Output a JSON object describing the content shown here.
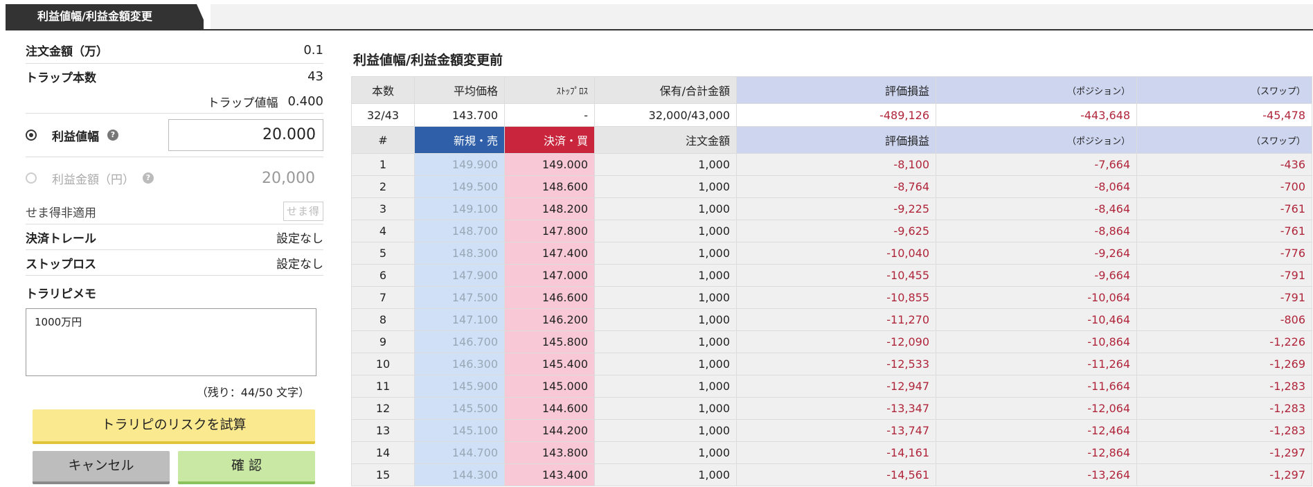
{
  "tab": {
    "active_label": "利益値幅/利益金額変更"
  },
  "form": {
    "order_amount_label": "注文金額（万）",
    "order_amount_value": "0.1",
    "trap_count_label": "トラップ本数",
    "trap_count_value": "43",
    "trap_width_label": "トラップ値幅",
    "trap_width_value": "0.400",
    "profit_width_label": "利益値幅",
    "profit_width_value": "20.000",
    "profit_amount_label": "利益金額（円）",
    "profit_amount_value": "20,000",
    "sema_label": "せま得非適用",
    "sema_icon_text": "せま得",
    "trail_label": "決済トレール",
    "trail_value": "設定なし",
    "stoploss_label": "ストップロス",
    "stoploss_value": "設定なし",
    "memo_label": "トラリピメモ",
    "memo_value": "1000万円",
    "remaining": "（残り：44/50 文字）",
    "risk_button": "トラリピのリスクを試算",
    "cancel_button": "キャンセル",
    "confirm_button": "確 認",
    "help_glyph": "?"
  },
  "summary": {
    "title": "利益値幅/利益金額変更前",
    "headers": [
      "本数",
      "平均価格",
      "ｽﾄｯﾌﾟﾛｽ",
      "保有/合計金額",
      "評価損益",
      "（ポジション）",
      "（スワップ）"
    ],
    "values": [
      "32/43",
      "143.700",
      "-",
      "32,000/43,000",
      "-489,126",
      "-443,648",
      "-45,478"
    ]
  },
  "table": {
    "headers": [
      "#",
      "新規・売",
      "決済・買",
      "注文金額",
      "評価損益",
      "（ポジション）",
      "（スワップ）"
    ],
    "rows": [
      [
        "1",
        "149.900",
        "149.000",
        "1,000",
        "-8,100",
        "-7,664",
        "-436"
      ],
      [
        "2",
        "149.500",
        "148.600",
        "1,000",
        "-8,764",
        "-8,064",
        "-700"
      ],
      [
        "3",
        "149.100",
        "148.200",
        "1,000",
        "-9,225",
        "-8,464",
        "-761"
      ],
      [
        "4",
        "148.700",
        "147.800",
        "1,000",
        "-9,625",
        "-8,864",
        "-761"
      ],
      [
        "5",
        "148.300",
        "147.400",
        "1,000",
        "-10,040",
        "-9,264",
        "-776"
      ],
      [
        "6",
        "147.900",
        "147.000",
        "1,000",
        "-10,455",
        "-9,664",
        "-791"
      ],
      [
        "7",
        "147.500",
        "146.600",
        "1,000",
        "-10,855",
        "-10,064",
        "-791"
      ],
      [
        "8",
        "147.100",
        "146.200",
        "1,000",
        "-11,270",
        "-10,464",
        "-806"
      ],
      [
        "9",
        "146.700",
        "145.800",
        "1,000",
        "-12,090",
        "-10,864",
        "-1,226"
      ],
      [
        "10",
        "146.300",
        "145.400",
        "1,000",
        "-12,533",
        "-11,264",
        "-1,269"
      ],
      [
        "11",
        "145.900",
        "145.000",
        "1,000",
        "-12,947",
        "-11,664",
        "-1,283"
      ],
      [
        "12",
        "145.500",
        "144.600",
        "1,000",
        "-13,347",
        "-12,064",
        "-1,283"
      ],
      [
        "13",
        "145.100",
        "144.200",
        "1,000",
        "-13,747",
        "-12,464",
        "-1,283"
      ],
      [
        "14",
        "144.700",
        "143.800",
        "1,000",
        "-14,161",
        "-12,864",
        "-1,297"
      ],
      [
        "15",
        "144.300",
        "143.400",
        "1,000",
        "-14,561",
        "-13,264",
        "-1,297"
      ]
    ]
  }
}
